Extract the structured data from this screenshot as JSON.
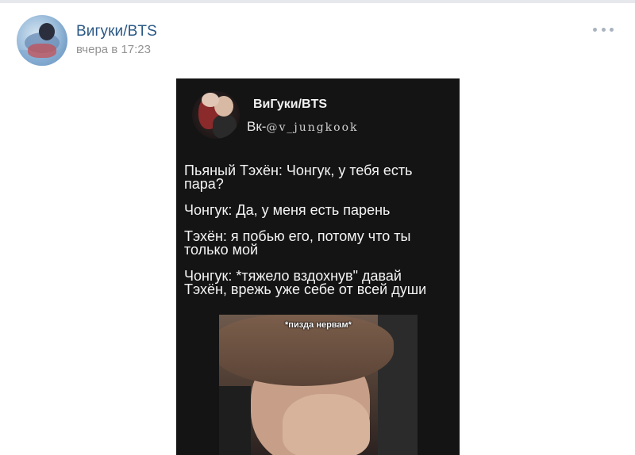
{
  "post": {
    "author": "Вигуки/BTS",
    "time": "вчера в 17:23"
  },
  "image": {
    "inner_title": "ВиГуки/BTS",
    "inner_prefix": "Вк-",
    "inner_handle": "@v_jungkook",
    "lines": [
      "Пьяный Тэхён: Чонгук, у тебя есть",
      "пара?",
      "Чонгук: Да, у меня есть парень",
      "Тэхён: я побью его, потому что ты",
      "только мой",
      "Чонгук: *тяжело вздохнув\" давай",
      "Тэхён, врежь уже себе от всей души"
    ],
    "meme_caption": "*пизда  нервам*"
  },
  "icons": {
    "more": "more-dots-icon"
  }
}
